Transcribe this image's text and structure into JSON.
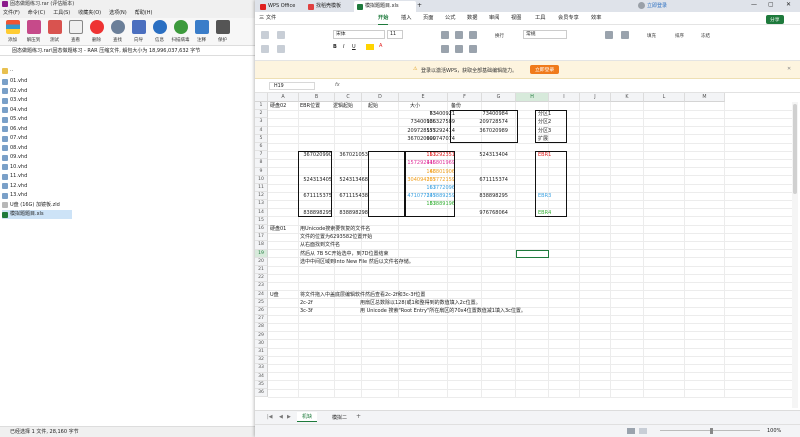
{
  "rar": {
    "title": "固态做题练习.rar (评估版本)",
    "menu": [
      "文件(F)",
      "命令(C)",
      "工具(S)",
      "收藏夹(O)",
      "选项(N)",
      "帮助(H)"
    ],
    "toolbar": [
      "添加",
      "解压到",
      "测试",
      "查看",
      "删除",
      "查找",
      "向导",
      "信息",
      "扫描病毒",
      "注释",
      "保护"
    ],
    "path": "固态做题练习.rar\\固态做题练习 - RAR 压缩文件, 解包大小为 18,996,037,632 字节",
    "files": [
      "..",
      "01.vhd",
      "02.vhd",
      "03.vhd",
      "04.vhd",
      "05.vhd",
      "06.vhd",
      "07.vhd",
      "08.vhd",
      "09.vhd",
      "10.vhd",
      "11.vhd",
      "12.vhd",
      "13.vhd",
      "U盘 (16G) 加镜板.zld",
      "模拟题题目.xls"
    ],
    "selected_file": "模拟题题目.xls",
    "status": "已经选择 1 文件, 28,160 字节"
  },
  "wps": {
    "tabs": {
      "home": "WPS Office",
      "template": "找稻壳模板",
      "doc": "模拟题题目.xls"
    },
    "login": "立即登录",
    "ribbon_tabs": [
      "三 文件",
      "开始",
      "插入",
      "页面",
      "公式",
      "数据",
      "审阅",
      "视图",
      "工具",
      "会员专享",
      "效率"
    ],
    "active_ribbon": "开始",
    "share": "分享",
    "toolbar_labels": {
      "font": "宋体",
      "size": "11",
      "wrap": "换行",
      "general": "常规",
      "fill": "填充",
      "sort": "排序",
      "freeze": "冻结"
    },
    "notice": "登录以激活WPS，获取全部基础编辑能力。",
    "notice_button": "立即登录",
    "cell_ref": "H19",
    "formula_icons": [
      "fx"
    ],
    "columns": [
      "A",
      "B",
      "C",
      "D",
      "E",
      "F",
      "G",
      "H",
      "I",
      "J",
      "K",
      "L",
      "M"
    ],
    "rows": [
      "1",
      "2",
      "3",
      "4",
      "5",
      "6",
      "7",
      "8",
      "9",
      "10",
      "11",
      "12",
      "13",
      "14",
      "15",
      "16",
      "17",
      "18",
      "19",
      "20",
      "21",
      "22",
      "23",
      "24",
      "25",
      "26",
      "27",
      "28",
      "29",
      "30",
      "31",
      "32",
      "33",
      "34",
      "35",
      "36"
    ],
    "cells": {
      "r1": [
        "硬盘02",
        "EBR位置",
        "逻辑起始",
        "起始",
        "大小",
        "备份"
      ],
      "r2": [
        "63",
        "73400921",
        "73400984",
        "分区1"
      ],
      "r3": [
        "73400985",
        "136327589",
        "209728574",
        "分区2"
      ],
      "r4": [
        "209728575",
        "157292414",
        "367020989",
        "分区3"
      ],
      "r5": [
        "367020990",
        "609747074",
        "扩展"
      ],
      "r7": [
        "367020990",
        "367021053",
        "63",
        "157292351",
        "524313404",
        "EBR1"
      ],
      "r8": [
        "157292415",
        "146801969"
      ],
      "r9": [
        "63",
        "146801906"
      ],
      "r10": [
        "524313405",
        "524313468",
        "304094235",
        "167772159",
        "671115374"
      ],
      "r11": [
        "63",
        "167772096"
      ],
      "r12": [
        "671115375",
        "671115438",
        "471077245",
        "137889259",
        "838898295",
        "EBR3"
      ],
      "r13": [
        "63",
        "137889196"
      ],
      "r14": [
        "838898295",
        "838898298",
        "976768064",
        "EBR4"
      ],
      "r19": [
        "硬盘01",
        "用Unicode搜索要恢复的文件名"
      ],
      "r20": [
        "文件的位置为6293582位置开始"
      ],
      "r21": [
        "从右面找到文件名"
      ],
      "r22": [
        "然后从 7B 5C开始选中，到7D位置结束"
      ],
      "r23": [
        "选中中间区域到Into  New File 然后以文件名存储。"
      ],
      "r26": [
        "U盘",
        "将文件拖入中盖底层编辑软件然后查看2c-2f和3c-3f位置"
      ],
      "r27": [
        "2c-2f",
        "用扇区总数除以128(或1和整得到的数值填入2c位置。"
      ],
      "r28": [
        "3c-3f",
        "用 Unicode 搜索\"Root Entry\"所在扇区的70x4位置数值减1填入3c位置。"
      ]
    },
    "sheets": [
      "机缺",
      "模拟二"
    ],
    "zoom": "100%"
  },
  "colors": {
    "wps_green": "#1e7a3c",
    "red_text": "#e02020",
    "pink_text": "#e0309a",
    "orange_text": "#f0a020",
    "blue_text": "#3aa0e0",
    "green_text": "#38b038"
  }
}
